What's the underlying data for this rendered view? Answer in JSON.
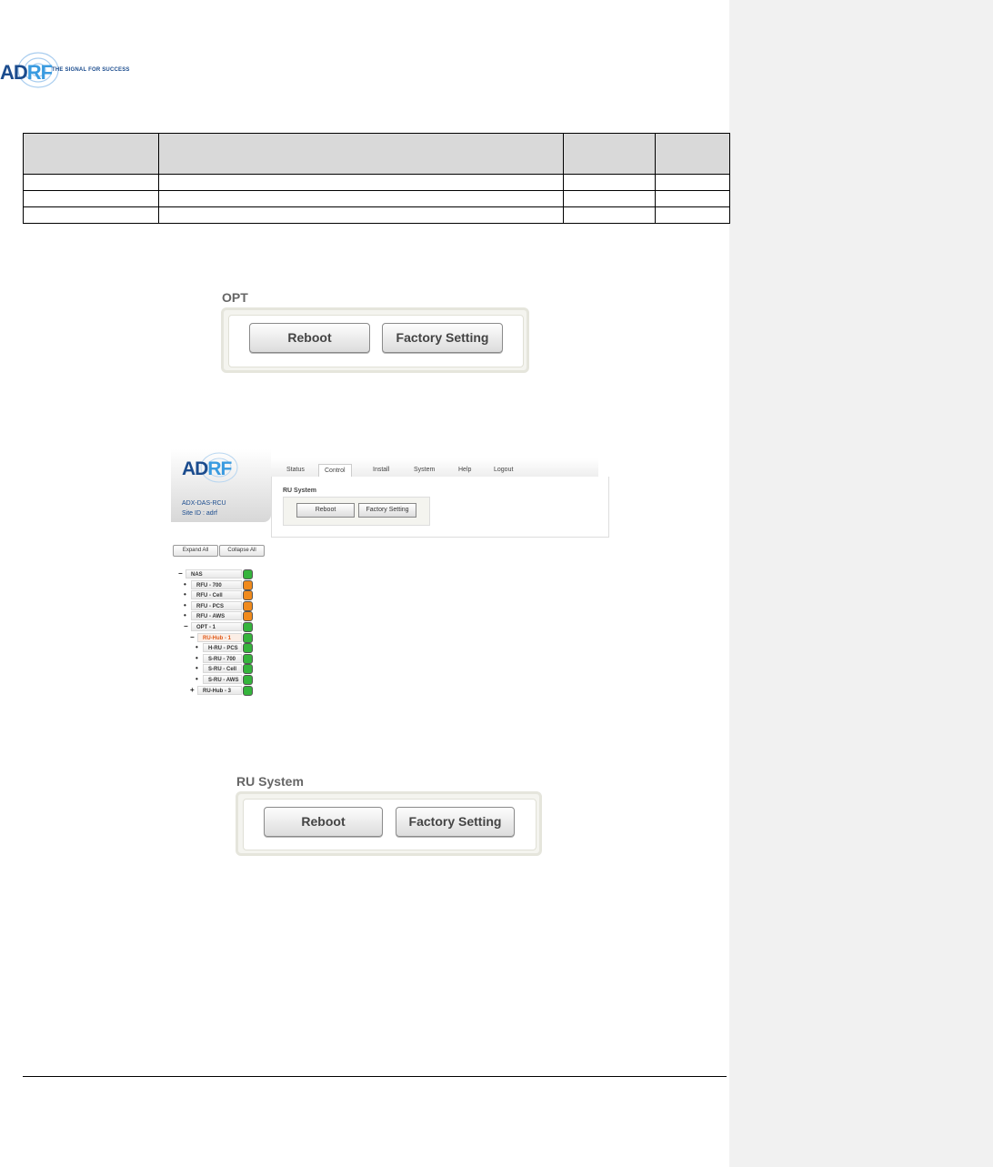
{
  "header": {
    "logo_letters": "ADRF",
    "tagline": "THE SIGNAL FOR SUCCESS"
  },
  "opt_panel": {
    "title": "OPT",
    "reboot_label": "Reboot",
    "factory_label": "Factory Setting"
  },
  "web_ui": {
    "logo": "ADRF",
    "device_name": "ADX-DAS-RCU",
    "site_id": "Site ID : adrf",
    "tabs": [
      "Status",
      "Control",
      "Install",
      "System",
      "Help",
      "Logout"
    ],
    "active_tab": "Control",
    "section_title": "RU System",
    "reboot_label": "Reboot",
    "factory_label": "Factory Setting",
    "expand_all": "Expand All",
    "collapse_all": "Collapse All",
    "tree": [
      {
        "toggle": "−",
        "label": "NAS",
        "status": "green",
        "indent": 0,
        "highlight": false
      },
      {
        "toggle": "•",
        "label": "RFU - 700",
        "status": "orange",
        "indent": 1,
        "highlight": false
      },
      {
        "toggle": "•",
        "label": "RFU - Cell",
        "status": "orange",
        "indent": 1,
        "highlight": false
      },
      {
        "toggle": "•",
        "label": "RFU - PCS",
        "status": "orange",
        "indent": 1,
        "highlight": false
      },
      {
        "toggle": "•",
        "label": "RFU - AWS",
        "status": "orange",
        "indent": 1,
        "highlight": false
      },
      {
        "toggle": "−",
        "label": "OPT - 1",
        "status": "green",
        "indent": 1,
        "highlight": false
      },
      {
        "toggle": "−",
        "label": "RU-Hub - 1",
        "status": "green",
        "indent": 2,
        "highlight": true
      },
      {
        "toggle": "•",
        "label": "H-RU - PCS",
        "status": "green",
        "indent": 3,
        "highlight": false
      },
      {
        "toggle": "•",
        "label": "S-RU - 700",
        "status": "green",
        "indent": 3,
        "highlight": false
      },
      {
        "toggle": "•",
        "label": "S-RU - Cell",
        "status": "green",
        "indent": 3,
        "highlight": false
      },
      {
        "toggle": "•",
        "label": "S-RU - AWS",
        "status": "green",
        "indent": 3,
        "highlight": false
      },
      {
        "toggle": "+",
        "label": "RU-Hub - 3",
        "status": "green",
        "indent": 2,
        "highlight": false
      }
    ]
  },
  "ru_panel": {
    "title": "RU System",
    "reboot_label": "Reboot",
    "factory_label": "Factory Setting"
  },
  "colors": {
    "brand_dark": "#1b4c8e",
    "brand_light": "#3a9be0",
    "status_green": "#35b43c",
    "status_orange": "#f08a1c",
    "sidebar": "#f1f1f1"
  }
}
